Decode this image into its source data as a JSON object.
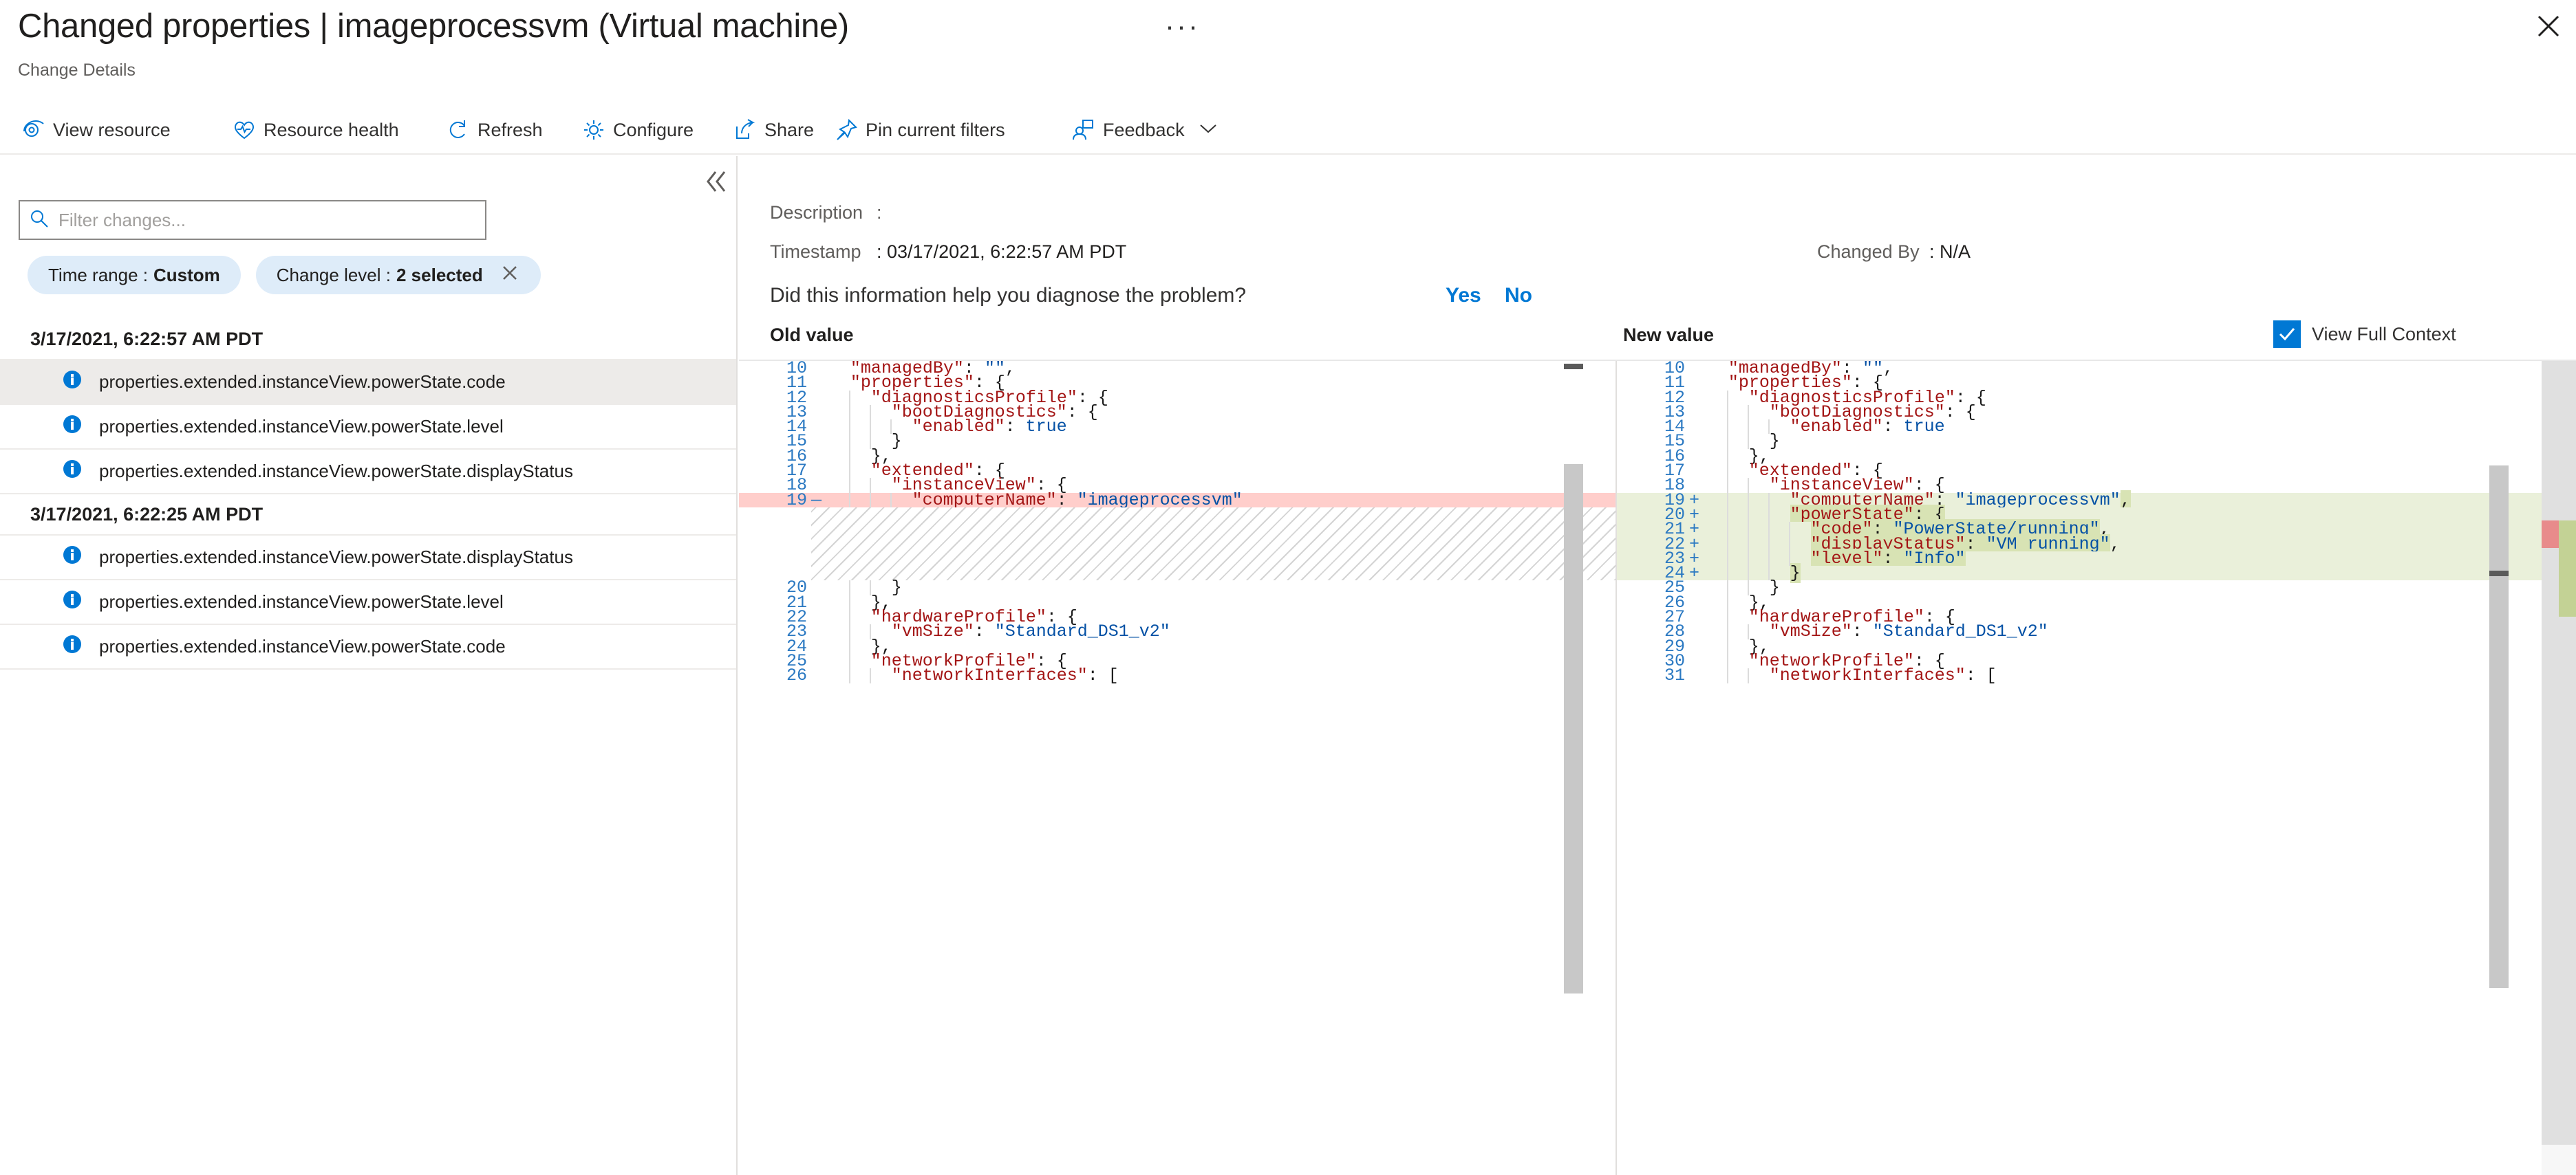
{
  "blade": {
    "title": "Changed properties | imageprocessvm (Virtual machine)",
    "subtitle": "Change Details",
    "ellipsis": "···",
    "close_icon": "close-icon"
  },
  "command_bar": {
    "items": [
      {
        "label": "View resource",
        "icon": "eye-icon"
      },
      {
        "label": "Resource health",
        "icon": "heart-pulse-icon"
      },
      {
        "label": "Refresh",
        "icon": "refresh-icon"
      },
      {
        "label": "Configure",
        "icon": "gear-icon"
      },
      {
        "label": "Share",
        "icon": "share-icon"
      },
      {
        "label": "Pin current filters",
        "icon": "pin-icon"
      },
      {
        "label": "Feedback",
        "icon": "feedback-person-icon",
        "chevron": true
      }
    ]
  },
  "left_panel": {
    "collapse_icon": "double-chevron-left-icon",
    "search": {
      "placeholder": "Filter changes...",
      "value": "",
      "icon": "search-icon"
    },
    "pills": [
      {
        "label": "Time range :",
        "value": "Custom",
        "dismissable": false
      },
      {
        "label": "Change level :",
        "value": "2 selected",
        "dismissable": true
      }
    ],
    "groups": [
      {
        "timestamp": "3/17/2021, 6:22:57 AM PDT",
        "rows": [
          {
            "label": "properties.extended.instanceView.powerState.code",
            "selected": true
          },
          {
            "label": "properties.extended.instanceView.powerState.level",
            "selected": false
          },
          {
            "label": "properties.extended.instanceView.powerState.displayStatus",
            "selected": false
          }
        ]
      },
      {
        "timestamp": "3/17/2021, 6:22:25 AM PDT",
        "rows": [
          {
            "label": "properties.extended.instanceView.powerState.displayStatus",
            "selected": false
          },
          {
            "label": "properties.extended.instanceView.powerState.level",
            "selected": false
          },
          {
            "label": "properties.extended.instanceView.powerState.code",
            "selected": false
          }
        ]
      }
    ]
  },
  "details": {
    "description_label": "Description",
    "description_colon": ":",
    "description_value": "",
    "timestamp_label": "Timestamp",
    "timestamp_value": ": 03/17/2021, 6:22:57 AM PDT",
    "changed_by_label": "Changed By",
    "changed_by_value": ": N/A",
    "feedback_prompt": "Did this information help you diagnose the problem?",
    "feedback_yes": "Yes",
    "feedback_no": "No"
  },
  "diff": {
    "old_value_label": "Old value",
    "new_value_label": "New value",
    "view_full_context_label": "View Full Context",
    "view_full_context_checked": true,
    "accent_color": "#0078d4",
    "delete_bg": "#ffcecb",
    "add_bg": "#eaf0da",
    "add_highlight_bg": "#d8e3b4",
    "key_color": "#a31515",
    "string_color": "#0451a5",
    "gutter_color": "#2b79c2",
    "old_lines": [
      {
        "n": "10",
        "sign": "",
        "indent": 1,
        "type": "ctx",
        "tokens": [
          {
            "t": "k",
            "v": "\"managedBy\""
          },
          {
            "t": "p",
            "v": ": "
          },
          {
            "t": "s",
            "v": "\"\""
          },
          {
            "t": "p",
            "v": ","
          }
        ]
      },
      {
        "n": "11",
        "sign": "",
        "indent": 1,
        "type": "ctx",
        "tokens": [
          {
            "t": "k",
            "v": "\"properties\""
          },
          {
            "t": "p",
            "v": ": {"
          }
        ]
      },
      {
        "n": "12",
        "sign": "",
        "indent": 2,
        "type": "ctx",
        "tokens": [
          {
            "t": "k",
            "v": "\"diagnosticsProfile\""
          },
          {
            "t": "p",
            "v": ": {"
          }
        ]
      },
      {
        "n": "13",
        "sign": "",
        "indent": 3,
        "type": "ctx",
        "tokens": [
          {
            "t": "k",
            "v": "\"bootDiagnostics\""
          },
          {
            "t": "p",
            "v": ": {"
          }
        ]
      },
      {
        "n": "14",
        "sign": "",
        "indent": 4,
        "type": "ctx",
        "tokens": [
          {
            "t": "k",
            "v": "\"enabled\""
          },
          {
            "t": "p",
            "v": ": "
          },
          {
            "t": "s",
            "v": "true"
          }
        ]
      },
      {
        "n": "15",
        "sign": "",
        "indent": 3,
        "type": "ctx",
        "tokens": [
          {
            "t": "p",
            "v": "}"
          }
        ]
      },
      {
        "n": "16",
        "sign": "",
        "indent": 2,
        "type": "ctx",
        "tokens": [
          {
            "t": "p",
            "v": "},"
          }
        ]
      },
      {
        "n": "17",
        "sign": "",
        "indent": 2,
        "type": "ctx",
        "tokens": [
          {
            "t": "k",
            "v": "\"extended\""
          },
          {
            "t": "p",
            "v": ": {"
          }
        ]
      },
      {
        "n": "18",
        "sign": "",
        "indent": 3,
        "type": "ctx",
        "tokens": [
          {
            "t": "k",
            "v": "\"instanceView\""
          },
          {
            "t": "p",
            "v": ": {"
          }
        ]
      },
      {
        "n": "19",
        "sign": "—",
        "indent": 4,
        "type": "del",
        "tokens": [
          {
            "t": "k",
            "v": "\"computerName\""
          },
          {
            "t": "p",
            "v": ": "
          },
          {
            "t": "s",
            "v": "\"imageprocessvm\""
          }
        ]
      },
      {
        "n": "",
        "sign": "",
        "indent": 0,
        "type": "filler",
        "rows": 5
      },
      {
        "n": "20",
        "sign": "",
        "indent": 3,
        "type": "ctx",
        "tokens": [
          {
            "t": "p",
            "v": "}"
          }
        ]
      },
      {
        "n": "21",
        "sign": "",
        "indent": 2,
        "type": "ctx",
        "tokens": [
          {
            "t": "p",
            "v": "},"
          }
        ]
      },
      {
        "n": "22",
        "sign": "",
        "indent": 2,
        "type": "ctx",
        "tokens": [
          {
            "t": "k",
            "v": "\"hardwareProfile\""
          },
          {
            "t": "p",
            "v": ": {"
          }
        ]
      },
      {
        "n": "23",
        "sign": "",
        "indent": 3,
        "type": "ctx",
        "tokens": [
          {
            "t": "k",
            "v": "\"vmSize\""
          },
          {
            "t": "p",
            "v": ": "
          },
          {
            "t": "s",
            "v": "\"Standard_DS1_v2\""
          }
        ]
      },
      {
        "n": "24",
        "sign": "",
        "indent": 2,
        "type": "ctx",
        "tokens": [
          {
            "t": "p",
            "v": "},"
          }
        ]
      },
      {
        "n": "25",
        "sign": "",
        "indent": 2,
        "type": "ctx",
        "tokens": [
          {
            "t": "k",
            "v": "\"networkProfile\""
          },
          {
            "t": "p",
            "v": ": {"
          }
        ]
      },
      {
        "n": "26",
        "sign": "",
        "indent": 3,
        "type": "ctx",
        "tokens": [
          {
            "t": "k",
            "v": "\"networkInterfaces\""
          },
          {
            "t": "p",
            "v": ": ["
          }
        ]
      }
    ],
    "new_lines": [
      {
        "n": "10",
        "sign": "",
        "indent": 1,
        "type": "ctx",
        "tokens": [
          {
            "t": "k",
            "v": "\"managedBy\""
          },
          {
            "t": "p",
            "v": ": "
          },
          {
            "t": "s",
            "v": "\"\""
          },
          {
            "t": "p",
            "v": ","
          }
        ]
      },
      {
        "n": "11",
        "sign": "",
        "indent": 1,
        "type": "ctx",
        "tokens": [
          {
            "t": "k",
            "v": "\"properties\""
          },
          {
            "t": "p",
            "v": ": {"
          }
        ]
      },
      {
        "n": "12",
        "sign": "",
        "indent": 2,
        "type": "ctx",
        "tokens": [
          {
            "t": "k",
            "v": "\"diagnosticsProfile\""
          },
          {
            "t": "p",
            "v": ": {"
          }
        ]
      },
      {
        "n": "13",
        "sign": "",
        "indent": 3,
        "type": "ctx",
        "tokens": [
          {
            "t": "k",
            "v": "\"bootDiagnostics\""
          },
          {
            "t": "p",
            "v": ": {"
          }
        ]
      },
      {
        "n": "14",
        "sign": "",
        "indent": 4,
        "type": "ctx",
        "tokens": [
          {
            "t": "k",
            "v": "\"enabled\""
          },
          {
            "t": "p",
            "v": ": "
          },
          {
            "t": "s",
            "v": "true"
          }
        ]
      },
      {
        "n": "15",
        "sign": "",
        "indent": 3,
        "type": "ctx",
        "tokens": [
          {
            "t": "p",
            "v": "}"
          }
        ]
      },
      {
        "n": "16",
        "sign": "",
        "indent": 2,
        "type": "ctx",
        "tokens": [
          {
            "t": "p",
            "v": "},"
          }
        ]
      },
      {
        "n": "17",
        "sign": "",
        "indent": 2,
        "type": "ctx",
        "tokens": [
          {
            "t": "k",
            "v": "\"extended\""
          },
          {
            "t": "p",
            "v": ": {"
          }
        ]
      },
      {
        "n": "18",
        "sign": "",
        "indent": 3,
        "type": "ctx",
        "tokens": [
          {
            "t": "k",
            "v": "\"instanceView\""
          },
          {
            "t": "p",
            "v": ": {"
          }
        ]
      },
      {
        "n": "19",
        "sign": "+",
        "indent": 4,
        "type": "add",
        "tokens": [
          {
            "t": "k",
            "v": "\"computerName\""
          },
          {
            "t": "p",
            "v": ": "
          },
          {
            "t": "s",
            "v": "\"imageprocessvm\""
          },
          {
            "t": "p hl",
            "v": ","
          }
        ]
      },
      {
        "n": "20",
        "sign": "+",
        "indent": 4,
        "type": "add",
        "tokens": [
          {
            "t": "k hl",
            "v": "\"powerState\""
          },
          {
            "t": "p hl",
            "v": ": {"
          }
        ]
      },
      {
        "n": "21",
        "sign": "+",
        "indent": 5,
        "type": "add",
        "tokens": [
          {
            "t": "k hl",
            "v": "\"code\""
          },
          {
            "t": "p hl",
            "v": ": "
          },
          {
            "t": "s hl",
            "v": "\"PowerState/running\""
          },
          {
            "t": "p",
            "v": ","
          }
        ]
      },
      {
        "n": "22",
        "sign": "+",
        "indent": 5,
        "type": "add",
        "tokens": [
          {
            "t": "k hl",
            "v": "\"displayStatus\""
          },
          {
            "t": "p hl",
            "v": ": "
          },
          {
            "t": "s hl",
            "v": "\"VM running\""
          },
          {
            "t": "p",
            "v": ","
          }
        ]
      },
      {
        "n": "23",
        "sign": "+",
        "indent": 5,
        "type": "add",
        "tokens": [
          {
            "t": "k hl",
            "v": "\"level\""
          },
          {
            "t": "p hl",
            "v": ": "
          },
          {
            "t": "s hl",
            "v": "\"Info\""
          }
        ]
      },
      {
        "n": "24",
        "sign": "+",
        "indent": 4,
        "type": "add",
        "tokens": [
          {
            "t": "p hl",
            "v": "}"
          }
        ]
      },
      {
        "n": "25",
        "sign": "",
        "indent": 3,
        "type": "ctx",
        "tokens": [
          {
            "t": "p",
            "v": "}"
          }
        ]
      },
      {
        "n": "26",
        "sign": "",
        "indent": 2,
        "type": "ctx",
        "tokens": [
          {
            "t": "p",
            "v": "},"
          }
        ]
      },
      {
        "n": "27",
        "sign": "",
        "indent": 2,
        "type": "ctx",
        "tokens": [
          {
            "t": "k",
            "v": "\"hardwareProfile\""
          },
          {
            "t": "p",
            "v": ": {"
          }
        ]
      },
      {
        "n": "28",
        "sign": "",
        "indent": 3,
        "type": "ctx",
        "tokens": [
          {
            "t": "k",
            "v": "\"vmSize\""
          },
          {
            "t": "p",
            "v": ": "
          },
          {
            "t": "s",
            "v": "\"Standard_DS1_v2\""
          }
        ]
      },
      {
        "n": "29",
        "sign": "",
        "indent": 2,
        "type": "ctx",
        "tokens": [
          {
            "t": "p",
            "v": "},"
          }
        ]
      },
      {
        "n": "30",
        "sign": "",
        "indent": 2,
        "type": "ctx",
        "tokens": [
          {
            "t": "k",
            "v": "\"networkProfile\""
          },
          {
            "t": "p",
            "v": ": {"
          }
        ]
      },
      {
        "n": "31",
        "sign": "",
        "indent": 3,
        "type": "ctx",
        "tokens": [
          {
            "t": "k",
            "v": "\"networkInterfaces\""
          },
          {
            "t": "p",
            "v": ": ["
          }
        ]
      }
    ]
  }
}
